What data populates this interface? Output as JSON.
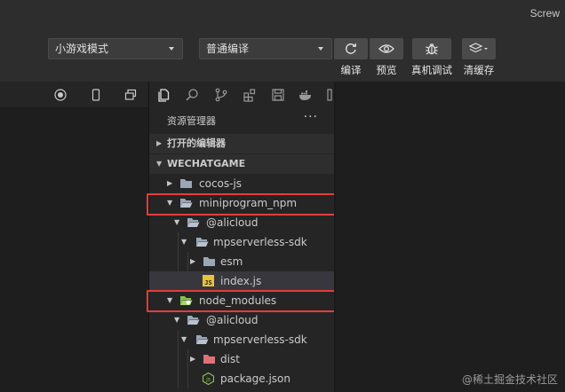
{
  "app": {
    "title": "Screw"
  },
  "toolbar": {
    "mode_select": "小游戏模式",
    "compile_select": "普通编译",
    "compile_label": "编译",
    "preview_label": "预览",
    "device_debug_label": "真机调试",
    "clear_cache_label": "清缓存"
  },
  "explorer": {
    "title": "资源管理器",
    "more": "···",
    "open_editors": "打开的编辑器",
    "project": "WECHATGAME",
    "tree": [
      {
        "label": "cocos-js"
      },
      {
        "label": "miniprogram_npm"
      },
      {
        "label": "@alicloud"
      },
      {
        "label": "mpserverless-sdk"
      },
      {
        "label": "esm"
      },
      {
        "label": "index.js"
      },
      {
        "label": "node_modules"
      },
      {
        "label": "@alicloud"
      },
      {
        "label": "mpserverless-sdk"
      },
      {
        "label": "dist"
      },
      {
        "label": "package.json"
      }
    ]
  },
  "watermark": "@稀土掘金技术社区",
  "colors": {
    "highlight_box": "#e53c3c",
    "folder": "#9aa7b5",
    "js_badge": "#e8c23a",
    "node_folder": "#8bc34a",
    "dist_folder": "#e0707a"
  }
}
